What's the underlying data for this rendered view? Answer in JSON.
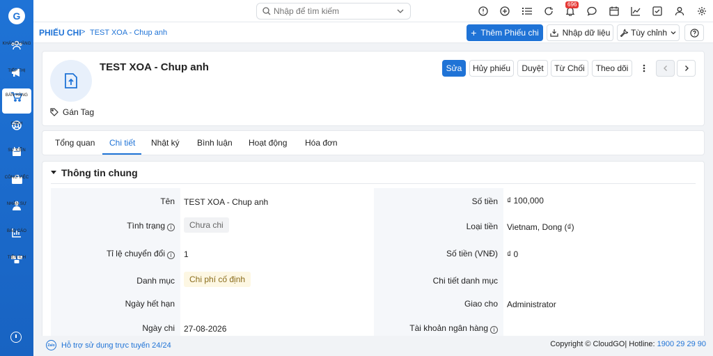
{
  "app": {
    "logo_letter": "G"
  },
  "sidebar": {
    "items": [
      {
        "label": "KHÁCH HÀNG",
        "icon": "users-icon"
      },
      {
        "label": "TIẾP THỊ",
        "icon": "megaphone-icon"
      },
      {
        "label": "BÁN HÀNG",
        "icon": "cart-icon",
        "active": true
      },
      {
        "label": "CSKH",
        "icon": "lifebuoy-icon"
      },
      {
        "label": "SỰ KIỆN",
        "icon": "calendar-icon"
      },
      {
        "label": "CÔNG VIỆC",
        "icon": "briefcase-icon"
      },
      {
        "label": "NHÂN SỰ",
        "icon": "person-icon"
      },
      {
        "label": "BÁO CÁO",
        "icon": "chart-icon"
      },
      {
        "label": "TIỆN ÍCH",
        "icon": "boxes-icon"
      }
    ]
  },
  "topbar": {
    "search_placeholder": "Nhập để tìm kiếm",
    "notification_count": "696"
  },
  "breadcrumb": {
    "module": "PHIẾU CHI",
    "separator": ">",
    "record": "TEST XOA - Chup anh"
  },
  "toolbar": {
    "add_label": "Thêm Phiếu chi",
    "import_label": "Nhập dữ liệu",
    "customize_label": "Tùy chỉnh"
  },
  "record": {
    "title": "TEST XOA - Chup anh",
    "tag_label": "Gán Tag",
    "actions": [
      "Sửa",
      "Hủy phiếu",
      "Duyệt",
      "Từ Chối",
      "Theo dõi"
    ]
  },
  "tabs": [
    "Tổng quan",
    "Chi tiết",
    "Nhật ký",
    "Bình luận",
    "Hoạt động",
    "Hóa đơn"
  ],
  "detail": {
    "section_title": "Thông tin chung",
    "left": [
      {
        "label": "Tên",
        "value": "TEST XOA - Chup anh"
      },
      {
        "label": "Tình trạng",
        "value": "Chưa chi"
      },
      {
        "label": "Tỉ lệ chuyển đổi",
        "value": "1"
      },
      {
        "label": "Danh mục",
        "value": "Chi phí cố định"
      },
      {
        "label": "Ngày hết hạn",
        "value": ""
      },
      {
        "label": "Ngày chi",
        "value": "27-08-2026"
      }
    ],
    "right": [
      {
        "label": "Số tiền",
        "value": "₫ 100,000"
      },
      {
        "label": "Loại tiền",
        "value": "Vietnam, Dong (₫)"
      },
      {
        "label": "Số tiền (VNĐ)",
        "value": "₫ 0"
      },
      {
        "label": "Chi tiết danh mục",
        "value": ""
      },
      {
        "label": "Giao cho",
        "value": "Administrator"
      },
      {
        "label": "Tài khoản ngân hàng",
        "value": ""
      }
    ]
  },
  "footer": {
    "zalo_label": "Zalo",
    "support_text": "Hỗ trợ sử dụng trực tuyến 24/24",
    "copyright": "Copyright © CloudGO",
    "hotline_label": "| Hotline: ",
    "hotline_number": "1900 29 29 90"
  },
  "colors": {
    "primary": "#1f73d6",
    "sidebar": "#1863c2"
  }
}
